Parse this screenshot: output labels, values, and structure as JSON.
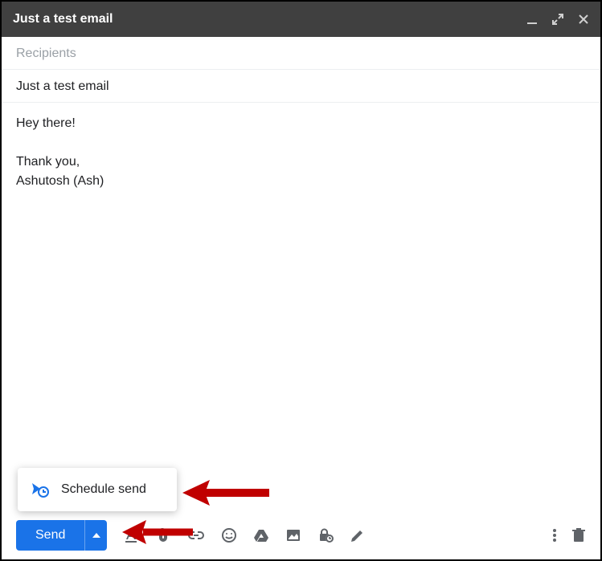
{
  "window": {
    "title": "Just a test email"
  },
  "fields": {
    "recipients_placeholder": "Recipients",
    "subject_value": "Just a test email"
  },
  "body": {
    "line1": "Hey there!",
    "line2": "",
    "line3": "Thank you,",
    "line4": "Ashutosh (Ash)"
  },
  "toolbar": {
    "send_label": "Send"
  },
  "popover": {
    "schedule_label": "Schedule send"
  },
  "icons": {
    "minimize": "minimize-icon",
    "expand": "expand-icon",
    "close": "close-icon",
    "caret_up": "caret-up-icon",
    "format": "formatting-icon",
    "attach": "attachment-icon",
    "link": "link-icon",
    "emoji": "emoji-icon",
    "drive": "drive-icon",
    "photo": "photo-icon",
    "confidential": "confidential-icon",
    "signature": "signature-icon",
    "more": "more-options-icon",
    "trash": "discard-icon",
    "schedule": "schedule-send-icon"
  },
  "colors": {
    "primary": "#1a73e8",
    "titlebar": "#404040",
    "icon": "#5f6368",
    "placeholder": "#9aa0a6",
    "text": "#202124",
    "arrow": "#c00000"
  }
}
